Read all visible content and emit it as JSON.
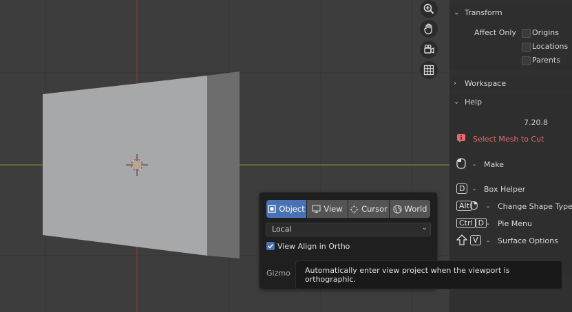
{
  "viewport": {
    "tools": [
      {
        "icon": "zoom-icon"
      },
      {
        "icon": "hand-pan-icon"
      },
      {
        "icon": "camera-view-icon"
      },
      {
        "icon": "grid-view-icon"
      }
    ]
  },
  "sidebar": {
    "transform": {
      "title": "Transform",
      "affect_only_label": "Affect Only",
      "options": [
        "Origins",
        "Locations",
        "Parents"
      ]
    },
    "workspace": {
      "title": "Workspace"
    },
    "help": {
      "title": "Help",
      "version": "7.20.8",
      "warning": "Select Mesh to Cut",
      "warning_color": "#e56b6b",
      "shortcuts": [
        {
          "keys": [],
          "icon": "mouse-icon",
          "label": "Make"
        },
        {
          "keys": [
            "D"
          ],
          "label": "Box Helper"
        },
        {
          "keys": [
            "Alt"
          ],
          "icon": "mouse-icon",
          "label": "Change Shape Type"
        },
        {
          "keys": [
            "Ctrl",
            "D"
          ],
          "label": "Pie Menu"
        },
        {
          "keys": [
            "V"
          ],
          "icon": "shift-icon",
          "label": "Surface Options"
        }
      ],
      "dash": "-"
    }
  },
  "popup": {
    "orientation_tabs": [
      {
        "label": "Object",
        "active": true
      },
      {
        "label": "View",
        "active": false
      },
      {
        "label": "Cursor",
        "active": false
      },
      {
        "label": "World",
        "active": false
      }
    ],
    "space_select": {
      "value": "Local"
    },
    "view_align": {
      "label": "View Align in Ortho",
      "checked": true
    },
    "gizmo_label": "Gizmo",
    "accent_color": "#4772b3"
  },
  "tooltip": {
    "text": "Automatically enter view project when the viewport is orthographic."
  }
}
